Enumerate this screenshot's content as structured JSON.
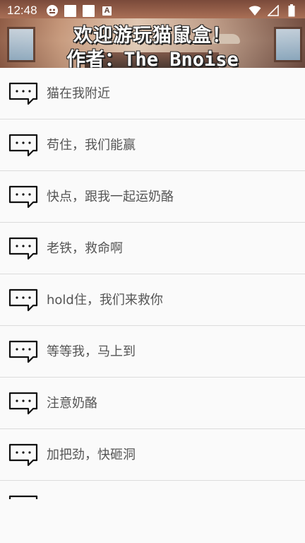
{
  "status_bar": {
    "time": "12:48",
    "icons": [
      "android-robot-icon",
      "square-notification-icon",
      "square-notification-icon",
      "a-badge-icon"
    ],
    "right_icons": [
      "wifi-icon",
      "signal-icon",
      "battery-icon"
    ],
    "a_badge_text": "A"
  },
  "banner": {
    "title": "欢迎游玩猫鼠盒！",
    "author": "作者：The_Bnoise"
  },
  "list": {
    "items": [
      {
        "label": "猫在我附近",
        "icon": "chat-bubble-icon"
      },
      {
        "label": "苟住，我们能赢",
        "icon": "chat-bubble-icon"
      },
      {
        "label": "快点，跟我一起运奶酪",
        "icon": "chat-bubble-icon"
      },
      {
        "label": "老铁，救命啊",
        "icon": "chat-bubble-icon"
      },
      {
        "label": "hold住，我们来救你",
        "icon": "chat-bubble-icon"
      },
      {
        "label": "等等我，马上到",
        "icon": "chat-bubble-icon"
      },
      {
        "label": "注意奶酪",
        "icon": "chat-bubble-icon"
      },
      {
        "label": "加把劲，快砸洞",
        "icon": "chat-bubble-icon"
      }
    ]
  },
  "colors": {
    "background": "#fafafa",
    "divider": "#dcdcdc",
    "item_text": "#555555",
    "icon_stroke": "#111111"
  }
}
